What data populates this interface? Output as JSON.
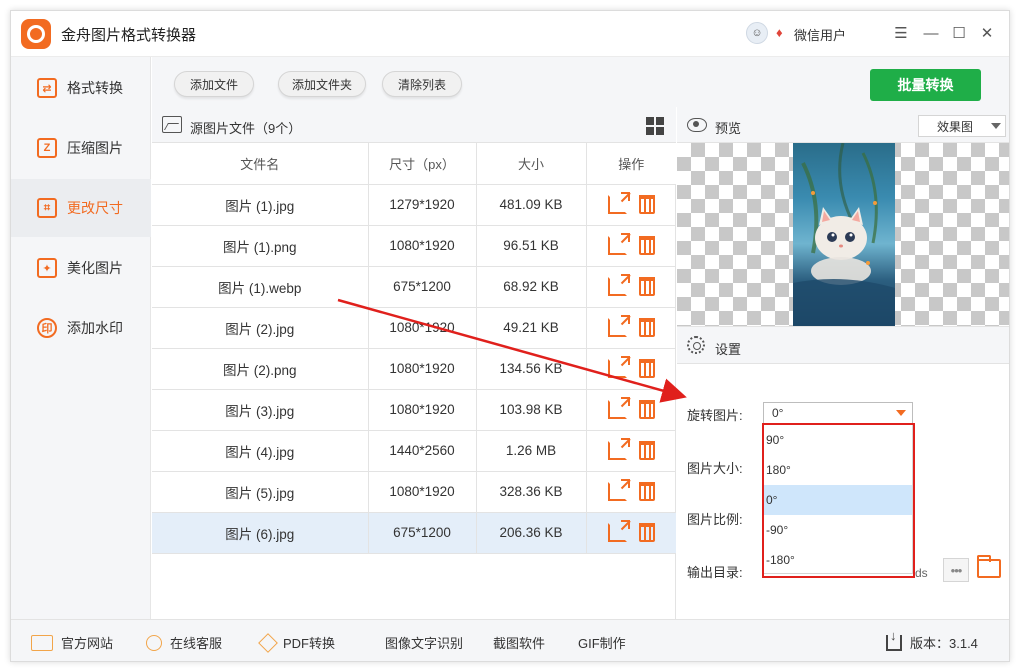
{
  "app": {
    "title": "金舟图片格式转换器",
    "user_name": "微信用户",
    "brand_color": "#f26b21"
  },
  "window_controls": [
    "menu-icon",
    "minimize-icon",
    "maximize-icon",
    "close-icon"
  ],
  "sidebar": {
    "items": [
      {
        "label": "格式转换",
        "icon": "format-convert-icon",
        "active": false
      },
      {
        "label": "压缩图片",
        "icon": "compress-icon",
        "active": false
      },
      {
        "label": "更改尺寸",
        "icon": "resize-icon",
        "active": true
      },
      {
        "label": "美化图片",
        "icon": "beautify-icon",
        "active": false
      },
      {
        "label": "添加水印",
        "icon": "watermark-icon",
        "active": false
      }
    ]
  },
  "toolbar": {
    "add_file": "添加文件",
    "add_folder": "添加文件夹",
    "clear_list": "清除列表",
    "batch_convert": "批量转换",
    "batch_color": "#1fae48"
  },
  "file_panel": {
    "title": "源图片文件（9个）",
    "columns": [
      "文件名",
      "尺寸（px）",
      "大小",
      "操作"
    ],
    "rows": [
      {
        "name": "图片 (1).jpg",
        "size": "1279*1920",
        "filesize": "481.09 KB"
      },
      {
        "name": "图片 (1).png",
        "size": "1080*1920",
        "filesize": "96.51 KB"
      },
      {
        "name": "图片 (1).webp",
        "size": "675*1200",
        "filesize": "68.92 KB"
      },
      {
        "name": "图片 (2).jpg",
        "size": "1080*1920",
        "filesize": "49.21 KB"
      },
      {
        "name": "图片 (2).png",
        "size": "1080*1920",
        "filesize": "134.56 KB"
      },
      {
        "name": "图片 (3).jpg",
        "size": "1080*1920",
        "filesize": "103.98 KB"
      },
      {
        "name": "图片 (4).jpg",
        "size": "1440*2560",
        "filesize": "1.26 MB"
      },
      {
        "name": "图片 (5).jpg",
        "size": "1080*1920",
        "filesize": "328.36 KB"
      },
      {
        "name": "图片 (6).jpg",
        "size": "675*1200",
        "filesize": "206.36 KB",
        "selected": true
      }
    ]
  },
  "preview": {
    "title": "预览",
    "mode_selected": "效果图"
  },
  "settings": {
    "title": "设置",
    "rotate_label": "旋转图片:",
    "rotate_value": "0°",
    "rotate_options": [
      "90°",
      "180°",
      "0°",
      "-90°",
      "-180°"
    ],
    "rotate_selected_index": 2,
    "size_label": "图片大小:",
    "ratio_label": "图片比例:",
    "output_label": "输出目录:",
    "output_tail": "ds",
    "more_label": "•••"
  },
  "annotation": {
    "highlight_color": "#e0201c"
  },
  "bottom_bar": {
    "items": [
      {
        "label": "官方网站",
        "icon": "monitor-icon"
      },
      {
        "label": "在线客服",
        "icon": "support-icon"
      },
      {
        "label": "PDF转换",
        "icon": "pdf-icon"
      },
      {
        "label": "图像文字识别",
        "icon": ""
      },
      {
        "label": "截图软件",
        "icon": ""
      },
      {
        "label": "GIF制作",
        "icon": ""
      }
    ],
    "version": "版本：3.1.4"
  }
}
